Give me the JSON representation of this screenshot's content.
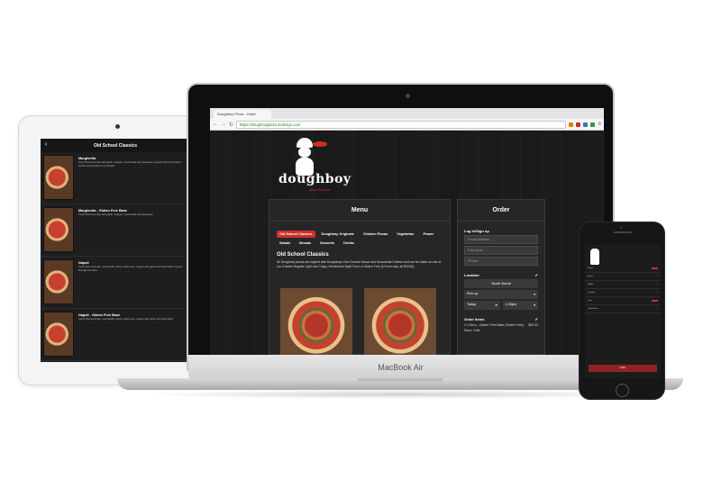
{
  "ipad": {
    "title": "Old School Classics",
    "back": "‹",
    "items": [
      {
        "name": "Margherita",
        "desc": "Fresh Roma tomato with garlic, oregano, fresh basil and parmesan, topped with fresh sliced tomato and premium mozzarella"
      },
      {
        "name": "Margherita - Gluten Free Base",
        "desc": "Fresh Roma tomato with garlic, oregano, fresh basil and parmesan"
      },
      {
        "name": "Napoli",
        "desc": "Fresh Roma tomato, mozzarella, olives, anchovies, capers with garlic and fresh basil, topped through the base"
      },
      {
        "name": "Napoli - Gluten Free Base",
        "desc": "Fresh Roma tomato, mozzarella, olives, anchovies, capers with garlic and fresh basil"
      }
    ]
  },
  "browser": {
    "tab_title": "Doughboy Pizza - Order",
    "url": "https://doughboypizza.mobi2go.com"
  },
  "site": {
    "logo_text": "doughboy",
    "logo_tag": "pizza with love"
  },
  "menu": {
    "title": "Menu",
    "categories": [
      "Old School Classics",
      "Doughboy Originals",
      "Chicken Pizzas",
      "Vegetarian",
      "Prawn",
      "Salads",
      "Breads",
      "Desserts",
      "Drinks"
    ],
    "section_title": "Old School Classics",
    "section_desc": "All Doughboy pizzas are topped with Doughboys Own Tomato Sauce and Mozzarella Cheese and can be made on one of our 3 bases Regular Light and Crispy, Wholemeal Spelt Flour or Gluten Free (10 inch only, all $18.50)."
  },
  "order": {
    "title": "Order",
    "login_label": "Log in/Sign up",
    "email_placeholder": "Email address",
    "fullname_placeholder": "Full name",
    "phone_placeholder": "Phone",
    "location_label": "Location",
    "location_value": "North Bondi",
    "method": "Pick up",
    "day": "Today",
    "time": "1:00pm",
    "items_label": "Order Items",
    "item_name": "1 x Deco - Gluten Free Base (Gluten Free)",
    "item_price": "$20.00",
    "item_note": "Deco: Gold"
  },
  "laptop": {
    "brand": "MacBook Air"
  },
  "iphone": {
    "rows": [
      "Name",
      "Email",
      "Mobile",
      "Location",
      "Time",
      "Order Items"
    ],
    "order_button": "Order"
  },
  "colors": {
    "accent": "#c9302c",
    "panel": "#262626"
  }
}
